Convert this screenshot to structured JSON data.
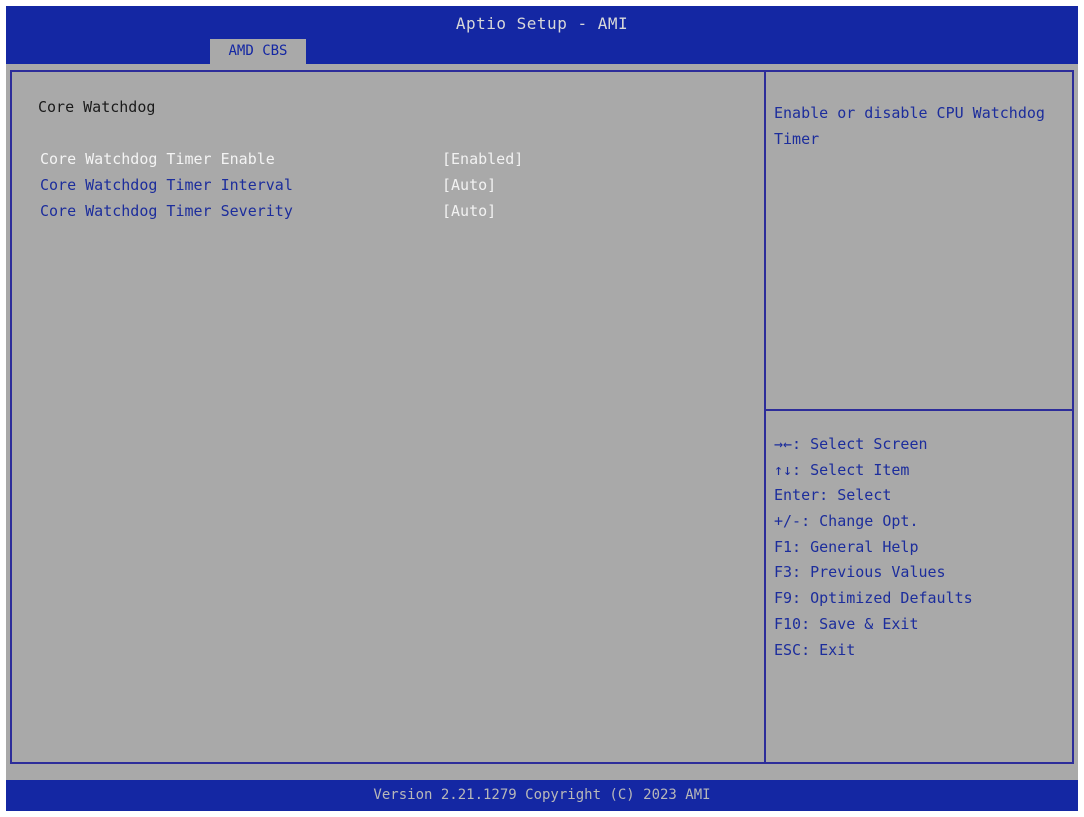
{
  "header": {
    "title": "Aptio Setup - AMI",
    "active_tab": "AMD CBS"
  },
  "main": {
    "section_title": "Core Watchdog",
    "settings": [
      {
        "label": "Core Watchdog Timer Enable",
        "value": "[Enabled]",
        "selected": true
      },
      {
        "label": "Core Watchdog Timer Interval",
        "value": "[Auto]",
        "selected": false
      },
      {
        "label": "Core Watchdog Timer Severity",
        "value": "[Auto]",
        "selected": false
      }
    ]
  },
  "help": {
    "description": "Enable or disable CPU Watchdog Timer",
    "keys": [
      "→←: Select Screen",
      "↑↓: Select Item",
      "Enter: Select",
      "+/-: Change Opt.",
      "F1: General Help",
      "F3: Previous Values",
      "F9: Optimized Defaults",
      "F10: Save & Exit",
      "ESC: Exit"
    ]
  },
  "footer": {
    "version": "Version 2.21.1279 Copyright (C) 2023 AMI"
  },
  "colors": {
    "header_bg": "#1427a3",
    "panel_bg": "#a9a9a9",
    "item_text": "#1c2d9c",
    "selected_text": "#f4f4f4"
  }
}
